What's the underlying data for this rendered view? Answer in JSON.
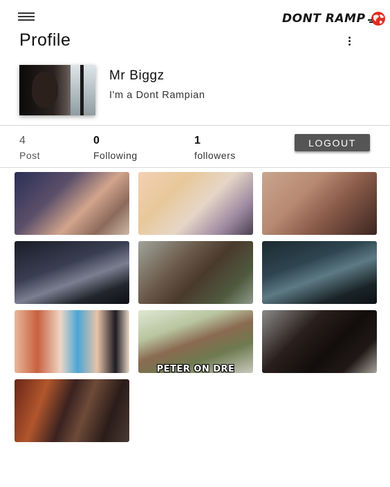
{
  "header": {
    "logo_text": "DONT RAMP",
    "logo_icon": "globe-icon",
    "menu_icon": "hamburger-menu-icon",
    "more_icon": "more-vertical-icon"
  },
  "page": {
    "title": "Profile"
  },
  "profile": {
    "name": "Mr Biggz",
    "bio": "I'm a Dont Rampian"
  },
  "stats": [
    {
      "value": "4",
      "label": "Post"
    },
    {
      "value": "0",
      "label": "Following"
    },
    {
      "value": "1",
      "label": "followers"
    }
  ],
  "actions": {
    "logout_label": "LOGOUT"
  },
  "posts": [
    {
      "caption": ""
    },
    {
      "caption": ""
    },
    {
      "caption": ""
    },
    {
      "caption": ""
    },
    {
      "caption": ""
    },
    {
      "caption": ""
    },
    {
      "caption": ""
    },
    {
      "caption": "PETER ON DRE"
    },
    {
      "caption": ""
    },
    {
      "caption": ""
    }
  ],
  "colors": {
    "logout_bg": "#555555",
    "globe_red": "#e02d1f"
  }
}
